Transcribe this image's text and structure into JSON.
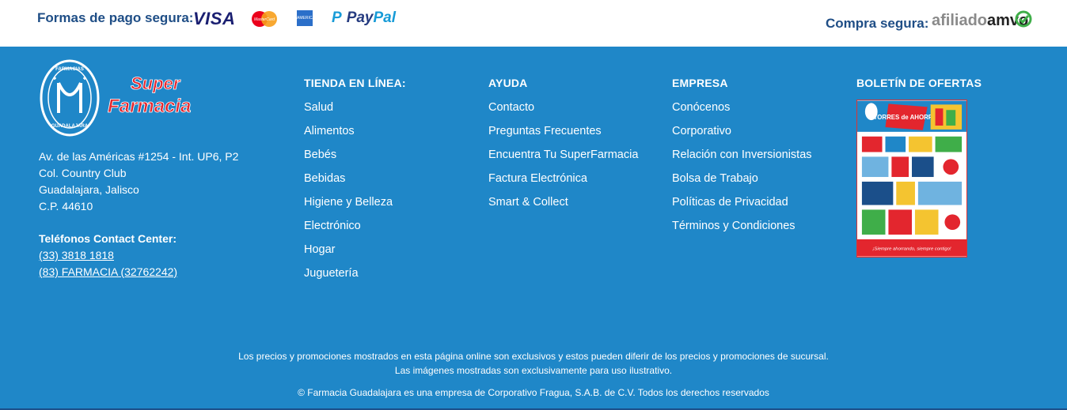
{
  "payments": {
    "label": "Formas de pago segura:",
    "visa": "VISA",
    "mastercard": "MasterCard",
    "amex": "AMERICAN EXPRESS",
    "paypal_pay": "Pay",
    "paypal_pal": "Pal"
  },
  "secure": {
    "label": "Compra segura:",
    "afiliado": "afiliado",
    "amvo": "amvo"
  },
  "brand": {
    "ring_top": "FARMACIAS",
    "ring_bottom": "GUADALAJARA",
    "wordmark_1": "Super",
    "wordmark_2": "Farmacia",
    "colors": {
      "footer_bg": "#1f87c8",
      "heading": "#1f4e86",
      "brand_red": "#e3262e"
    }
  },
  "address": {
    "line1": "Av. de las Américas #1254 - Int. UP6, P2",
    "line2": "Col. Country Club",
    "line3": "Guadalajara, Jalisco",
    "line4": "C.P. 44610"
  },
  "contact": {
    "title": "Teléfonos Contact Center:",
    "phone1": "(33) 3818 1818",
    "phone2": "(83) FARMACIA (32762242)"
  },
  "columns": {
    "tienda": {
      "title": "TIENDA EN LÍNEA:",
      "items": [
        "Salud",
        "Alimentos",
        "Bebés",
        "Bebidas",
        "Higiene y Belleza",
        "Electrónico",
        "Hogar",
        "Juguetería"
      ]
    },
    "ayuda": {
      "title": "AYUDA",
      "items": [
        "Contacto",
        "Preguntas Frecuentes",
        "Encuentra Tu SuperFarmacia",
        "Factura Electrónica",
        "Smart & Collect"
      ]
    },
    "empresa": {
      "title": "EMPRESA",
      "items": [
        "Conócenos",
        "Corporativo",
        "Relación con Inversionistas",
        "Bolsa de Trabajo",
        "Políticas de Privacidad",
        "Términos y Condiciones"
      ]
    },
    "boletin": {
      "title": "BOLETÍN DE OFERTAS",
      "flyer_headline": "TORRES de AHORRO",
      "flyer_footer": "¡Siempre ahorrando, siempre contigo!"
    }
  },
  "legal": {
    "line1": "Los precios y promociones mostrados en esta página online son exclusivos y estos pueden diferir de los precios y promociones de sucursal.",
    "line2": "Las imágenes mostradas son exclusivamente para uso ilustrativo.",
    "line3": "© Farmacia Guadalajara es una empresa de Corporativo Fragua, S.A.B. de C.V. Todos los derechos reservados"
  }
}
